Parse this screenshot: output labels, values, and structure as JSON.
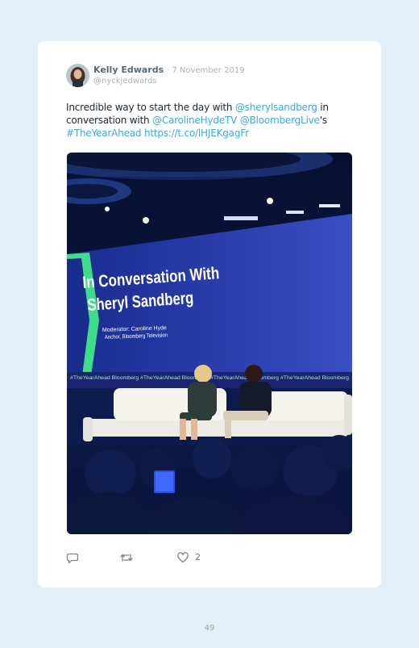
{
  "tweet": {
    "author_name": "Kelly Edwards",
    "separator": "·",
    "date": "7 November 2019",
    "handle": "@nyckjedwards",
    "text": {
      "part1": "Incredible way to start the day with ",
      "mention1": "@sherylsandberg",
      "part2": " in conversation with ",
      "mention2": "@CarolineHydeTV",
      "part3": " ",
      "mention3": "@BloombergLive",
      "part4": "'s ",
      "hashtag": "#TheYearAhead",
      "part5": " ",
      "url": "https://t.co/lHJEKgagFr"
    },
    "photo": {
      "screen_title_line1": "In Conversation With",
      "screen_title_line2": "Sheryl Sandberg",
      "screen_sub_line1": "Moderator: Caroline Hyde",
      "screen_sub_line2": "Anchor, Bloomberg Television",
      "ticker_text": "#TheYearAhead  Bloomberg  #TheYearAhead  Bloomberg  #TheYearAhead  Bloomberg  #TheYearAhead  Bloomberg"
    },
    "actions": {
      "reply_icon": "reply-icon",
      "retweet_icon": "retweet-icon",
      "like_icon": "heart-icon",
      "like_count": "2"
    },
    "colors": {
      "link": "#3ea6e6",
      "background": "#e3eef6",
      "card": "#ffffff"
    }
  },
  "page": {
    "number": "49"
  }
}
